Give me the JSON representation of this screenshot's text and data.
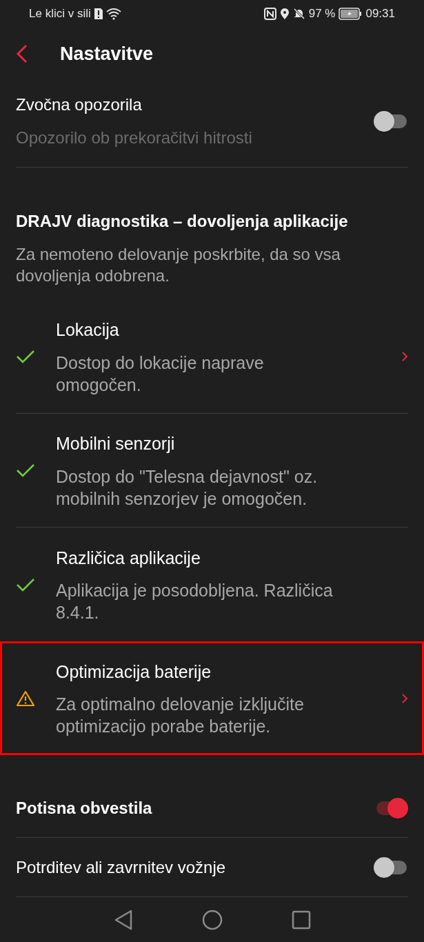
{
  "status_bar": {
    "carrier": "Le klici v sili",
    "battery": "97 %",
    "time": "09:31"
  },
  "header": {
    "title": "Nastavitve"
  },
  "sound_alerts": {
    "label": "Zvočna opozorila",
    "description": "Opozorilo ob prekoračitvi hitrosti",
    "on": false
  },
  "diagnostics": {
    "title": "DRAJV diagnostika – dovoljenja aplikacije",
    "description": "Za nemoteno delovanje poskrbite, da so vsa dovoljenja odobrena.",
    "items": [
      {
        "kind": "ok",
        "title": "Lokacija",
        "description": "Dostop do lokacije naprave omogočen.",
        "chevron": true,
        "highlighted": false
      },
      {
        "kind": "ok",
        "title": "Mobilni senzorji",
        "description": "Dostop do \"Telesna dejavnost\" oz. mobilnih senzorjev je omogočen.",
        "chevron": false,
        "highlighted": false
      },
      {
        "kind": "ok",
        "title": "Različica aplikacije",
        "description": "Aplikacija je posodobljena. Različica 8.4.1.",
        "chevron": false,
        "highlighted": false
      },
      {
        "kind": "warning",
        "title": "Optimizacija baterije",
        "description": "Za optimalno delovanje izključite optimizacijo porabe baterije.",
        "chevron": true,
        "highlighted": true
      }
    ]
  },
  "toggles": [
    {
      "label": "Potisna obvestila",
      "bold": true,
      "on": true
    },
    {
      "label": "Potrditev ali zavrnitev vožnje",
      "bold": false,
      "on": false
    }
  ]
}
